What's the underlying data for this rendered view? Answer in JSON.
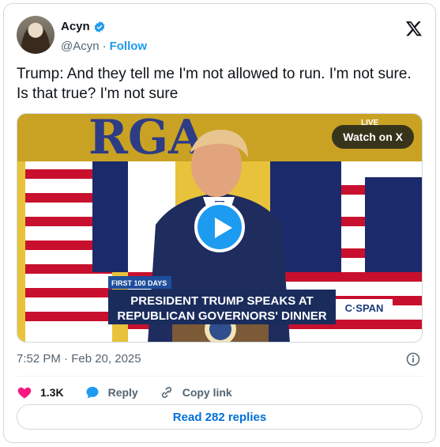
{
  "author": {
    "name": "Acyn",
    "handle": "@Acyn",
    "separator": "·",
    "follow_label": "Follow"
  },
  "tweet": {
    "text": "Trump: And they tell me I'm not allowed to run. I'm not sure. Is that true? I'm not sure",
    "timestamp": "7:52 PM · Feb 20, 2025"
  },
  "media": {
    "watch_label": "Watch on X",
    "caption_tag": "FIRST 100 DAYS",
    "caption_line1": "PRESIDENT TRUMP SPEAKS AT",
    "caption_line2": "REPUBLICAN GOVERNORS' DINNER",
    "network": "C·SPAN",
    "live_tag": "LIVE"
  },
  "actions": {
    "likes": "1.3K",
    "reply_label": "Reply",
    "copy_label": "Copy link"
  },
  "read_replies_label": "Read 282 replies",
  "colors": {
    "accent": "#1d9bf0",
    "like": "#f91880",
    "link": "#006fd6",
    "secondary_text": "#536471"
  },
  "icons": [
    "verified-badge-icon",
    "x-logo-icon",
    "info-icon",
    "heart-icon",
    "reply-bubble-icon",
    "link-icon",
    "play-icon"
  ]
}
